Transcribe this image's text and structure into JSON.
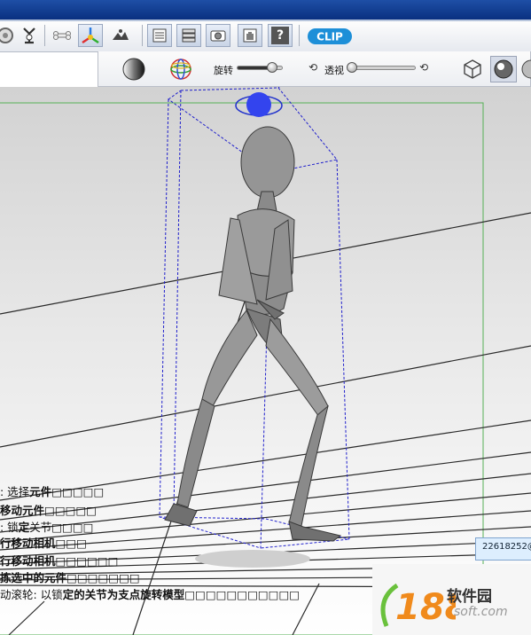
{
  "toolbar": {
    "buttons": [
      {
        "name": "rotate-view-icon"
      },
      {
        "name": "pose-joint-icon"
      },
      {
        "name": "bone-icon"
      },
      {
        "name": "transform-gizmo-icon"
      },
      {
        "name": "camera-angle-icon"
      },
      {
        "name": "list-panel-icon"
      },
      {
        "name": "layers-icon"
      },
      {
        "name": "camera-panel-icon"
      },
      {
        "name": "hand-pose-icon"
      },
      {
        "name": "help-icon"
      }
    ],
    "help_glyph": "?",
    "logo_text": "CLIP"
  },
  "subbar": {
    "rotate_label": "旋转",
    "rotate_value": 0.82,
    "perspective_label": "透视",
    "perspective_value": 0.04
  },
  "help": {
    "lines": [
      {
        "a": ": 选择",
        "b": "元件",
        "c": "□□□□□"
      },
      {
        "a": "",
        "b": "移动",
        "c": "元件□□□□□"
      },
      {
        "a": ": 锁",
        "b": "定",
        "c": "关节□□□□"
      },
      {
        "a": "",
        "b": "行移动",
        "c": "相机□□□"
      },
      {
        "a": "",
        "b": "行移动",
        "c": "相机□□□□□□"
      },
      {
        "a": "",
        "b": "拣选中的元件",
        "c": "□□□□□□□"
      },
      {
        "a": "动滚轮: 以锁",
        "b": "定的",
        "c": "关节为支点旋转模型□□□□□□□□□□□"
      }
    ]
  },
  "tooltip": {
    "text": "22618252@"
  },
  "watermark": {
    "name": "软件园",
    "badge": "188",
    "url": "soft.com"
  },
  "colors": {
    "accent": "#3344ee",
    "grid_line": "#2a2a2a",
    "bound_box": "#2020cc"
  }
}
